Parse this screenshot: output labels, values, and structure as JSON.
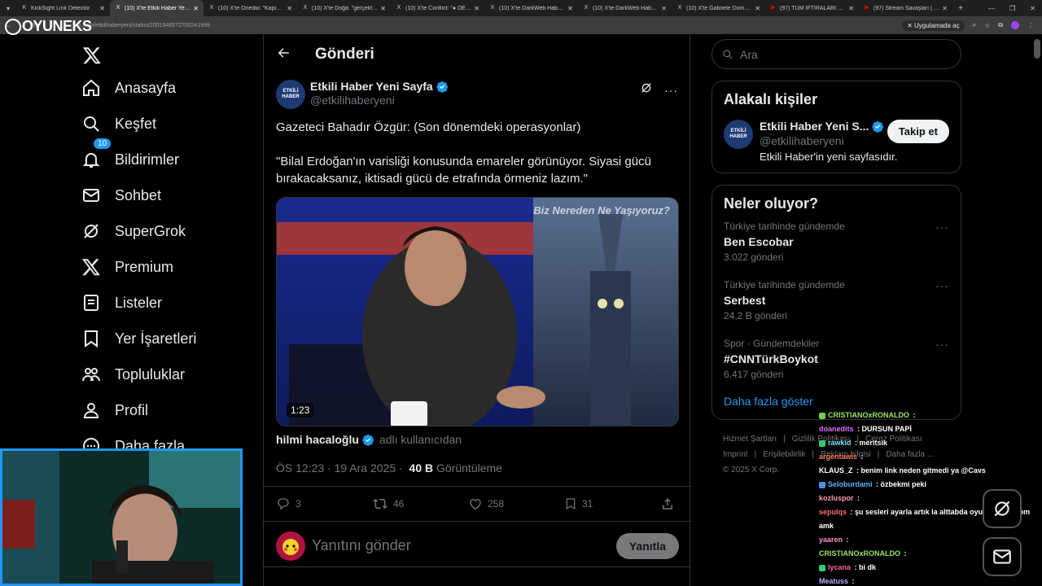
{
  "browser": {
    "tabs": [
      {
        "title": "KickSight Link Detector",
        "active": false,
        "icon": "k-icon"
      },
      {
        "title": "(10) X'te Etkili Haber Yeni Sayfa",
        "active": true,
        "icon": "x-icon"
      },
      {
        "title": "(10) X'te Onedio: \"Kapının önü...",
        "active": false,
        "icon": "x-icon"
      },
      {
        "title": "(10) X'te Doğa: \"gerçekten şu...",
        "active": false,
        "icon": "x-icon"
      },
      {
        "title": "(10) X'te Conflict: \"● DEM Pa...",
        "active": false,
        "icon": "x-icon"
      },
      {
        "title": "(10) X'te DarkWeb Haber: \"#...",
        "active": false,
        "icon": "x-icon"
      },
      {
        "title": "(10) X'te DarkWeb Haber: \"Bir...",
        "active": false,
        "icon": "x-icon"
      },
      {
        "title": "(10) X'te Gabriele Domaldo: \"...",
        "active": false,
        "icon": "x-icon"
      },
      {
        "title": "(97) TÜM İFTİRALARI ÇÖZDÜM...",
        "active": false,
        "icon": "youtube-icon"
      },
      {
        "title": "(97) Stream Savaşları | Ebo x...",
        "active": false,
        "icon": "youtube-icon"
      }
    ],
    "url": "x.com/etkilihaberyeni/status/2001946572700241999",
    "apps_button": "Uygulamada aç"
  },
  "logo": {
    "text": "OYUNEKS"
  },
  "nav": {
    "items": [
      {
        "label": "Anasayfa",
        "icon": "home-icon"
      },
      {
        "label": "Keşfet",
        "icon": "search-icon"
      },
      {
        "label": "Bildirimler",
        "icon": "bell-icon",
        "badge": "10"
      },
      {
        "label": "Sohbet",
        "icon": "mail-icon"
      },
      {
        "label": "SuperGrok",
        "icon": "grok-icon"
      },
      {
        "label": "Premium",
        "icon": "x-icon"
      },
      {
        "label": "Listeler",
        "icon": "list-icon"
      },
      {
        "label": "Yer İşaretleri",
        "icon": "bookmark-icon"
      },
      {
        "label": "Topluluklar",
        "icon": "people-icon"
      },
      {
        "label": "Profil",
        "icon": "person-icon"
      },
      {
        "label": "Daha fazla",
        "icon": "more-circle-icon"
      }
    ]
  },
  "post": {
    "header_title": "Gönderi",
    "author_name": "Etkili Haber Yeni Sayfa",
    "author_handle": "@etkilihaberyeni",
    "avatar_text": "ETKİLİ HABER",
    "text_line1": "Gazeteci Bahadır Özgür: (Son dönemdeki operasyonlar)",
    "text_line2": "\"Bilal Erdoğan'ın varisliği konusunda emareler görünüyor. Siyasi gücü bırakacaksanız, iktisadi gücü de etrafında örmeniz lazım.\"",
    "video_duration": "1:23",
    "video_overlay_text": "Biz Nereden Ne Yaşıyoruz?",
    "tagged_user": "hilmi hacaloğlu",
    "tagged_suffix": "adlı kullanıcıdan",
    "timestamp": "ÖS 12:23 · 19 Ara 2025 ·",
    "views": "40 B",
    "views_label": "Görüntüleme",
    "replies": "3",
    "reposts": "46",
    "likes": "258",
    "bookmarks": "31",
    "reply_placeholder": "Yanıtını gönder",
    "reply_button": "Yanıtla"
  },
  "right": {
    "search_placeholder": "Ara",
    "related_title": "Alakalı kişiler",
    "related_user": {
      "name": "Etkili Haber Yeni S...",
      "handle": "@etkilihaberyeni",
      "bio": "Etkili Haber'in yeni sayfasıdır.",
      "follow": "Takip et"
    },
    "trends_title": "Neler oluyor?",
    "trends": [
      {
        "context": "Türkiye tarihinde gündemde",
        "title": "Ben Escobar",
        "count": "3.022 gönderi"
      },
      {
        "context": "Türkiye tarihinde gündemde",
        "title": "Serbest",
        "count": "24,2 B gönderi"
      },
      {
        "context": "Spor · Gündemdekiler",
        "title": "#CNNTürkBoykot",
        "count": "6.417 gönderi"
      }
    ],
    "show_more": "Daha fazla göster",
    "footer": {
      "line1": [
        "Hizmet Şartları",
        "Gizlilik Politikası",
        "Çerez Politikası"
      ],
      "line2": [
        "Imprint",
        "Erişilebilirlik",
        "Reklam bilgisi",
        "Daha fazla ..."
      ],
      "copyright": "© 2025 X Corp."
    }
  },
  "chat": {
    "messages": [
      {
        "user": "CRISTIANOxRONALDO",
        "text": "",
        "color": "#9be36b",
        "badge": "#6fd14a"
      },
      {
        "user": "doanedits",
        "text": "DURSUN PAPİ",
        "color": "#e06bff",
        "badge": ""
      },
      {
        "user": "rawkid",
        "text": "meritsik",
        "color": "#7ee0ff",
        "badge": "#2ecc71"
      },
      {
        "user": "argentawis",
        "text": "",
        "color": "#ff7a5a",
        "badge": ""
      },
      {
        "user": "KLAUS_Z",
        "text": "benim link neden gitmedi ya @Cavs",
        "color": "#ffffff",
        "badge": ""
      },
      {
        "user": "Seloburdami",
        "text": "özbekmi peki",
        "color": "#5cb3ff",
        "badge": "#4a90e2"
      },
      {
        "user": "kozluspor",
        "text": "",
        "color": "#ff9db1",
        "badge": ""
      },
      {
        "user": "sepulqs",
        "text": "şu sesleri ayarla artık la alttabda oyun oynamıyom amk",
        "color": "#ff6b6b",
        "badge": ""
      },
      {
        "user": "yaaren",
        "text": "",
        "color": "#ff8fd1",
        "badge": ""
      },
      {
        "user": "CRISTIANOxRONALDO",
        "text": "",
        "color": "#9be36b",
        "badge": ""
      },
      {
        "user": "lycana",
        "text": "bi dk",
        "color": "#ff5fa2",
        "badge": "#2ecc71"
      },
      {
        "user": "Meatuss",
        "text": "",
        "color": "#c7a8ff",
        "badge": ""
      }
    ]
  }
}
